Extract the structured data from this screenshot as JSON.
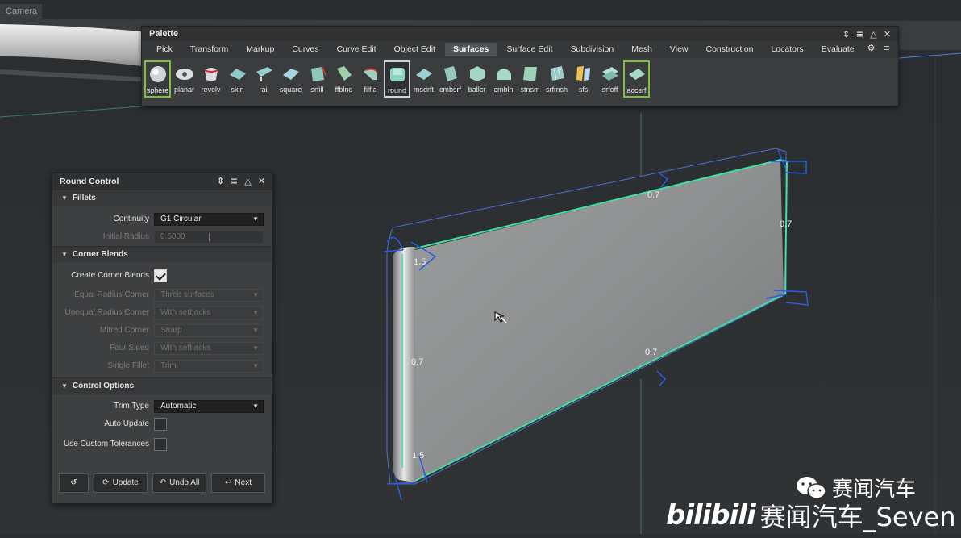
{
  "viewport": {
    "camera_label": "Camera",
    "cursor": "move-cursor"
  },
  "dimensions": {
    "top": "0.7",
    "top_right": "0.7",
    "left_top": "1.5",
    "left_mid": "0.7",
    "bottom": "0.7",
    "left_bottom": "1.5"
  },
  "palette": {
    "title": "Palette",
    "tabs": [
      "Pick",
      "Transform",
      "Markup",
      "Curves",
      "Curve Edit",
      "Object Edit",
      "Surfaces",
      "Surface Edit",
      "Subdivision",
      "Mesh",
      "View",
      "Construction",
      "Locators",
      "Evaluate"
    ],
    "active_tab": "Surfaces",
    "tools": [
      "sphere",
      "planar",
      "revolv",
      "skin",
      "rail",
      "square",
      "srfill",
      "ffblnd",
      "filfla",
      "round",
      "msdrft",
      "cmbsrf",
      "ballcr",
      "cmbln",
      "stnsm",
      "srfmsh",
      "sfs",
      "srfoff",
      "accsrf"
    ],
    "selected_tool": "round"
  },
  "round_control": {
    "title": "Round Control",
    "fillets": {
      "header": "Fillets",
      "continuity_label": "Continuity",
      "continuity_value": "G1 Circular",
      "initial_radius_label": "Initial Radius",
      "initial_radius_value": "0.5000"
    },
    "corner_blends": {
      "header": "Corner Blends",
      "create_label": "Create Corner Blends",
      "create_checked": true,
      "rows": [
        {
          "label": "Equal Radius Corner",
          "value": "Three surfaces"
        },
        {
          "label": "Unequal Radius Corner",
          "value": "With setbacks"
        },
        {
          "label": "Mitred Corner",
          "value": "Sharp"
        },
        {
          "label": "Four Sided",
          "value": "With setbacks"
        },
        {
          "label": "Single Fillet",
          "value": "Trim"
        }
      ]
    },
    "control_options": {
      "header": "Control Options",
      "trim_type_label": "Trim Type",
      "trim_type_value": "Automatic",
      "auto_update_label": "Auto Update",
      "custom_tol_label": "Use Custom Tolerances"
    },
    "buttons": {
      "update": "Update",
      "undo_all": "Undo All",
      "next": "Next"
    }
  },
  "watermark": {
    "wechat": "赛闻汽车",
    "bilibili_logo": "bilibili",
    "bilibili_text": "赛闻汽车_Seven"
  },
  "colors": {
    "accent_green": "#7fbf3b",
    "curve_green": "#3fe0a0",
    "curve_blue": "#2a5be0"
  }
}
